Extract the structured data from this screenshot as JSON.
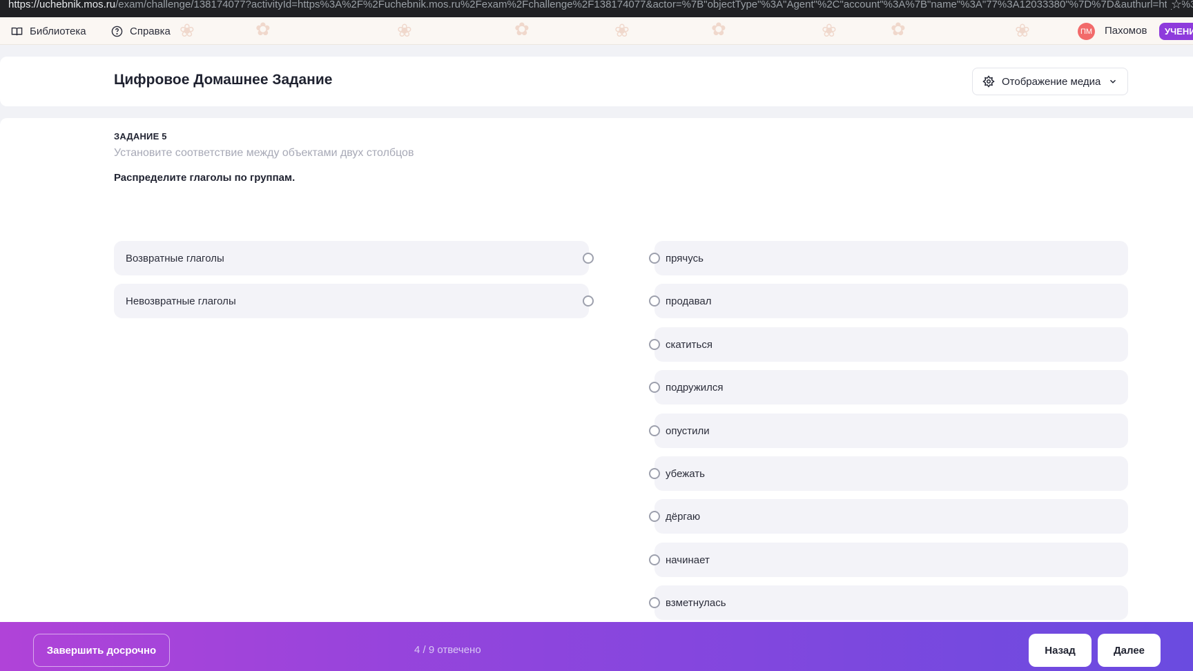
{
  "browser": {
    "url_host": "https://uchebnik.mos.ru",
    "url_rest": "/exam/challenge/138174077?activityId=https%3A%2F%2Fuchebnik.mos.ru%2Fexam%2Fchallenge%2F138174077&actor=%7B\"objectType\"%3A\"Agent\"%2C\"account\"%3A%7B\"name\"%3A\"77%3A12033380\"%7D%7D&authurl=https%3A%2F%2Fs..."
  },
  "topnav": {
    "library_label": "Библиотека",
    "help_label": "Справка",
    "avatar_initials": "ПМ",
    "username": "Пахомов",
    "role_badge": "УЧЕНИ"
  },
  "header": {
    "title": "Цифровое Домашнее Задание",
    "media_button_label": "Отображение медиа"
  },
  "task": {
    "number_label": "ЗАДАНИЕ 5",
    "description": "Установите соответствие между объектами двух столбцов",
    "instruction": "Распределите глаголы по группам.",
    "groups": [
      "Возвратные глаголы",
      "Невозвратные глаголы"
    ],
    "words": [
      "прячусь",
      "продавал",
      "скатиться",
      "подружился",
      "опустили",
      "убежать",
      "дёргаю",
      "начинает",
      "взметнулась"
    ]
  },
  "footer": {
    "finish_label": "Завершить досрочно",
    "progress": "4 / 9 отвечено",
    "back_label": "Назад",
    "next_label": "Далее"
  },
  "colors": {
    "footer_gradient_start": "#b043d8",
    "footer_gradient_end": "#6a4be0",
    "item_background": "#f3f3f8",
    "avatar": "#f26a6a",
    "role_badge": "#8e3bdc"
  },
  "icons": [
    "book-icon",
    "help-circle-icon",
    "flower-settings-icon",
    "chevron-down-icon",
    "star-icon"
  ]
}
